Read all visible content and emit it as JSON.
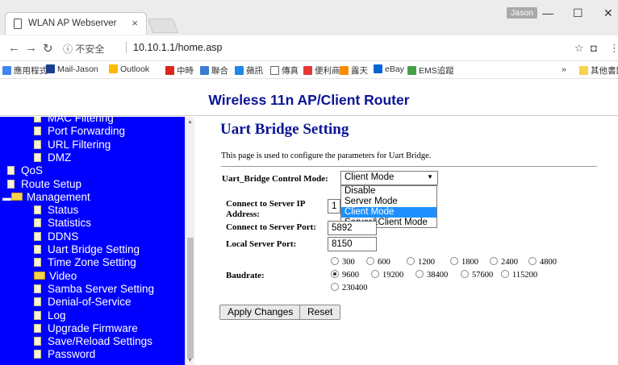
{
  "browser": {
    "tab_title": "WLAN AP Webserver",
    "tab_close": "×",
    "profile": "Jason",
    "minimize": "—",
    "maximize": "☐",
    "close": "✕",
    "security_label": "ⓘ 不安全",
    "url": "10.10.1.1/home.asp",
    "bookmarks": [
      {
        "label": "應用程式",
        "icon": "apps-grid-icon",
        "color": "#4285f4"
      },
      {
        "label": "Mail-Jason",
        "icon": "mail-icon",
        "color": "#1a3d8f"
      },
      {
        "label": "Outlook",
        "icon": "outlook-icon",
        "color": "#ffb900"
      },
      {
        "label": "中時",
        "icon": "chinatimes-icon",
        "color": "#d9261c"
      },
      {
        "label": "聯合",
        "icon": "udn-icon",
        "color": "#3a7bd5"
      },
      {
        "label": "蘋訊",
        "icon": "apple-daily-icon",
        "color": "#1e88e5"
      },
      {
        "label": "傳真",
        "icon": "page-icon",
        "color": "#ffffff"
      },
      {
        "label": "便利商",
        "icon": "shop-icon",
        "color": "#e53935"
      },
      {
        "label": "露天",
        "icon": "ruten-icon",
        "color": "#fb8c00"
      },
      {
        "label": "eBay",
        "icon": "ebay-icon",
        "color": "#0064d2"
      },
      {
        "label": "EMS追蹤",
        "icon": "ems-icon",
        "color": "#43a047"
      }
    ],
    "bookmarks_more": "»",
    "other_bookmarks": "其他書籤"
  },
  "banner": {
    "title": "Wireless 11n AP/Client Router"
  },
  "sidebar": {
    "items": [
      {
        "label": "MAC Filtering",
        "type": "page",
        "indent": 1
      },
      {
        "label": "Port Forwarding",
        "type": "page",
        "indent": 1
      },
      {
        "label": "URL Filtering",
        "type": "page",
        "indent": 1
      },
      {
        "label": "DMZ",
        "type": "page",
        "indent": 1
      },
      {
        "label": "QoS",
        "type": "page",
        "indent": 0
      },
      {
        "label": "Route Setup",
        "type": "page",
        "indent": 0
      },
      {
        "label": "Management",
        "type": "folder",
        "indent": 0
      },
      {
        "label": "Status",
        "type": "page",
        "indent": 1
      },
      {
        "label": "Statistics",
        "type": "page",
        "indent": 1
      },
      {
        "label": "DDNS",
        "type": "page",
        "indent": 1
      },
      {
        "label": "Uart Bridge Setting",
        "type": "page",
        "indent": 1
      },
      {
        "label": "Time Zone Setting",
        "type": "page",
        "indent": 1
      },
      {
        "label": "Video",
        "type": "folder",
        "indent": 1
      },
      {
        "label": "Samba Server Setting",
        "type": "page",
        "indent": 1
      },
      {
        "label": "Denial-of-Service",
        "type": "page",
        "indent": 1
      },
      {
        "label": "Log",
        "type": "page",
        "indent": 1
      },
      {
        "label": "Upgrade Firmware",
        "type": "page",
        "indent": 1
      },
      {
        "label": "Save/Reload Settings",
        "type": "page",
        "indent": 1
      },
      {
        "label": "Password",
        "type": "page",
        "indent": 1
      }
    ]
  },
  "main": {
    "title": "Uart Bridge Setting",
    "description": "This page is used to configure the parameters for Uart Bridge.",
    "mode_label": "Uart_Bridge Control Mode:",
    "mode_value": "Client Mode",
    "mode_options": [
      "Disable",
      "Server Mode",
      "Client Mode",
      "Server&Client Mode"
    ],
    "mode_selected_index": 2,
    "server_ip_label": "Connect to Server IP Address:",
    "server_ip_value": "10",
    "server_port_label": "Connect to Server Port:",
    "server_port_value": "5892",
    "local_port_label": "Local Server Port:",
    "local_port_value": "8150",
    "baudrate_label": "Baudrate:",
    "baudrates": [
      "300",
      "600",
      "1200",
      "1800",
      "2400",
      "4800",
      "9600",
      "19200",
      "38400",
      "57600",
      "115200",
      "230400"
    ],
    "baudrate_selected": "9600",
    "apply_label": "Apply Changes",
    "reset_label": "Reset"
  }
}
